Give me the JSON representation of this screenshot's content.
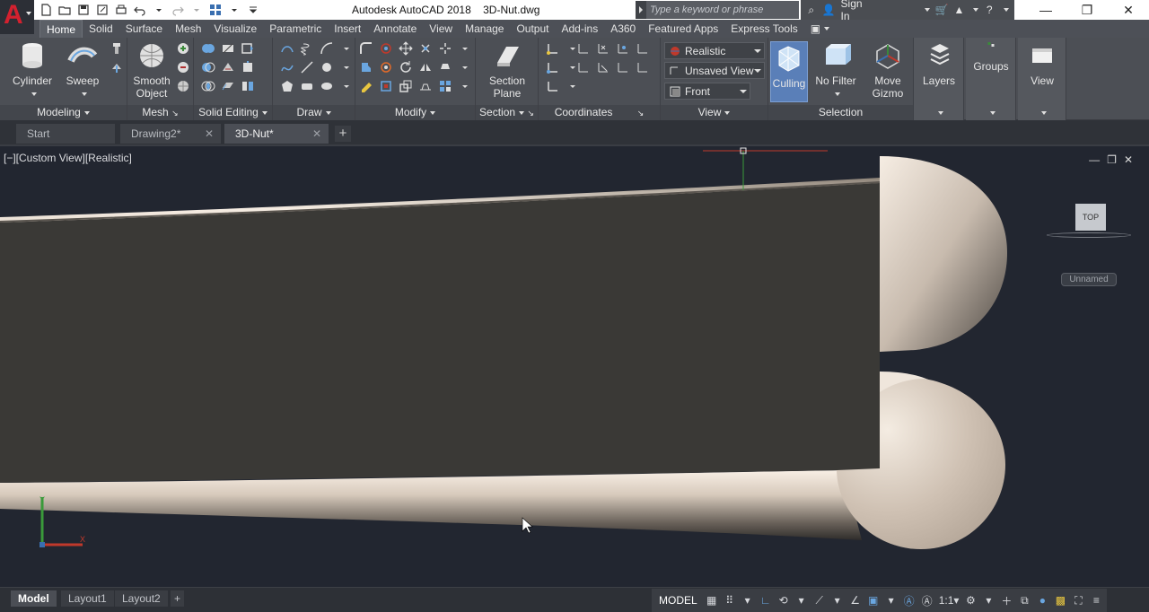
{
  "title_bar": {
    "app": "Autodesk AutoCAD 2018",
    "file": "3D-Nut.dwg",
    "search_placeholder": "Type a keyword or phrase",
    "sign_in": "Sign In"
  },
  "ribbon_tabs": [
    "Home",
    "Solid",
    "Surface",
    "Mesh",
    "Visualize",
    "Parametric",
    "Insert",
    "Annotate",
    "View",
    "Manage",
    "Output",
    "Add-ins",
    "A360",
    "Featured Apps",
    "Express Tools"
  ],
  "ribbon": {
    "modeling": {
      "label": "Modeling",
      "cylinder": "Cylinder",
      "sweep": "Sweep"
    },
    "mesh": {
      "label": "Mesh",
      "smooth_object": "Smooth Object"
    },
    "solid_editing": {
      "label": "Solid Editing"
    },
    "draw": {
      "label": "Draw"
    },
    "modify": {
      "label": "Modify"
    },
    "section": {
      "label": "Section",
      "section_plane": "Section Plane"
    },
    "coordinates": {
      "label": "Coordinates"
    },
    "view": {
      "label": "View",
      "visual_style": "Realistic",
      "saved_view": "Unsaved View",
      "named_view": "Front"
    },
    "selection": {
      "label": "Selection",
      "culling": "Culling",
      "no_filter": "No Filter",
      "move_gizmo": "Move Gizmo"
    },
    "layers": "Layers",
    "groups": "Groups",
    "view_btn": "View"
  },
  "file_tabs": [
    {
      "label": "Start"
    },
    {
      "label": "Drawing2*"
    },
    {
      "label": "3D-Nut*"
    }
  ],
  "viewport": {
    "label": "[−][Custom View][Realistic]",
    "viewcube": "TOP",
    "ucs": "Unnamed",
    "axis_y": "Y",
    "axis_x": "X"
  },
  "layout_tabs": [
    "Model",
    "Layout1",
    "Layout2"
  ],
  "status": {
    "space": "MODEL",
    "scale": "1:1"
  },
  "colors": {
    "accent": "#d3212f",
    "active_button": "#5a7fb8",
    "solid": "#3a3936"
  }
}
